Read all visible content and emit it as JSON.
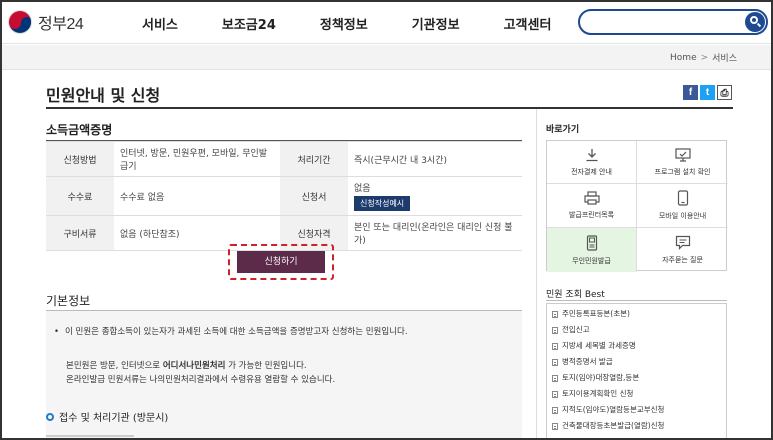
{
  "header": {
    "logo_text": "정부24",
    "nav": [
      "서비스",
      "보조금24",
      "정책정보",
      "기관정보",
      "고객센터"
    ],
    "search_placeholder": ""
  },
  "breadcrumb": {
    "home": "Home",
    "sep": ">",
    "current": "서비스"
  },
  "page_title": "민원안내 및 신청",
  "main": {
    "section_title": "소득금액증명",
    "table": {
      "r1": {
        "h1": "신청방법",
        "v1": "인터넷, 방문, 민원우편, 모바일, 무인발급기",
        "h2": "처리기간",
        "v2": "즉시(근무시간 내 3시간)"
      },
      "r2": {
        "h1": "수수료",
        "v1": "수수료 없음",
        "h2": "신청서",
        "v2": "없음",
        "v2_button": "신청작성예시"
      },
      "r3": {
        "h1": "구비서류",
        "v1": "없음 (하단참조)",
        "h2": "신청자격",
        "v2": "본인 또는 대리인(온라인은 대리인 신청 불가)"
      }
    },
    "apply_button": "신청하기",
    "basic_info_title": "기본정보",
    "bullet": "이 민원은 종합소득이 있는자가 과세된 소득에 대한 소득금액을 증명받고자 신청하는 민원입니다.",
    "para_line1_pre": "본민원은 방문, 인터넷으로 ",
    "para_line1_bold": "어디서나민원처리",
    "para_line1_post": " 가 가능한 민원입니다.",
    "para_line2": "온라인발급 민원서류는 나의민원처리결과에서 수령유용 열람할 수 있습니다.",
    "sub_title": "접수 및 처리기관 (방문시)"
  },
  "sidebar": {
    "quick_title": "바로가기",
    "quick_links": [
      {
        "label": "전자결제 안내",
        "icon": "download-icon"
      },
      {
        "label": "프로그램 설치 확인",
        "icon": "monitor-icon"
      },
      {
        "label": "발급프린터목록",
        "icon": "printer-icon"
      },
      {
        "label": "모바일 이용안내",
        "icon": "mobile-icon"
      },
      {
        "label": "무인민원발급",
        "icon": "kiosk-icon",
        "active": true
      },
      {
        "label": "자주묻는 질문",
        "icon": "chat-icon"
      }
    ],
    "best_title": "민원 조회 Best",
    "best_items": [
      "주민등록표등본(초본)",
      "전입신고",
      "지방세 세목별 과세증명",
      "병적증명서 발급",
      "토지(임야)대장열람,등본",
      "토지이용계획확인 신청",
      "지적도(임야도)열람등본교부신청",
      "건축물대장등초본발급(열람)신청"
    ]
  },
  "colors": {
    "brand_blue": "#1e4a92",
    "apply_button": "#5b2b49",
    "highlight_border": "#d0202a",
    "active_cell": "#e4f6e1"
  }
}
